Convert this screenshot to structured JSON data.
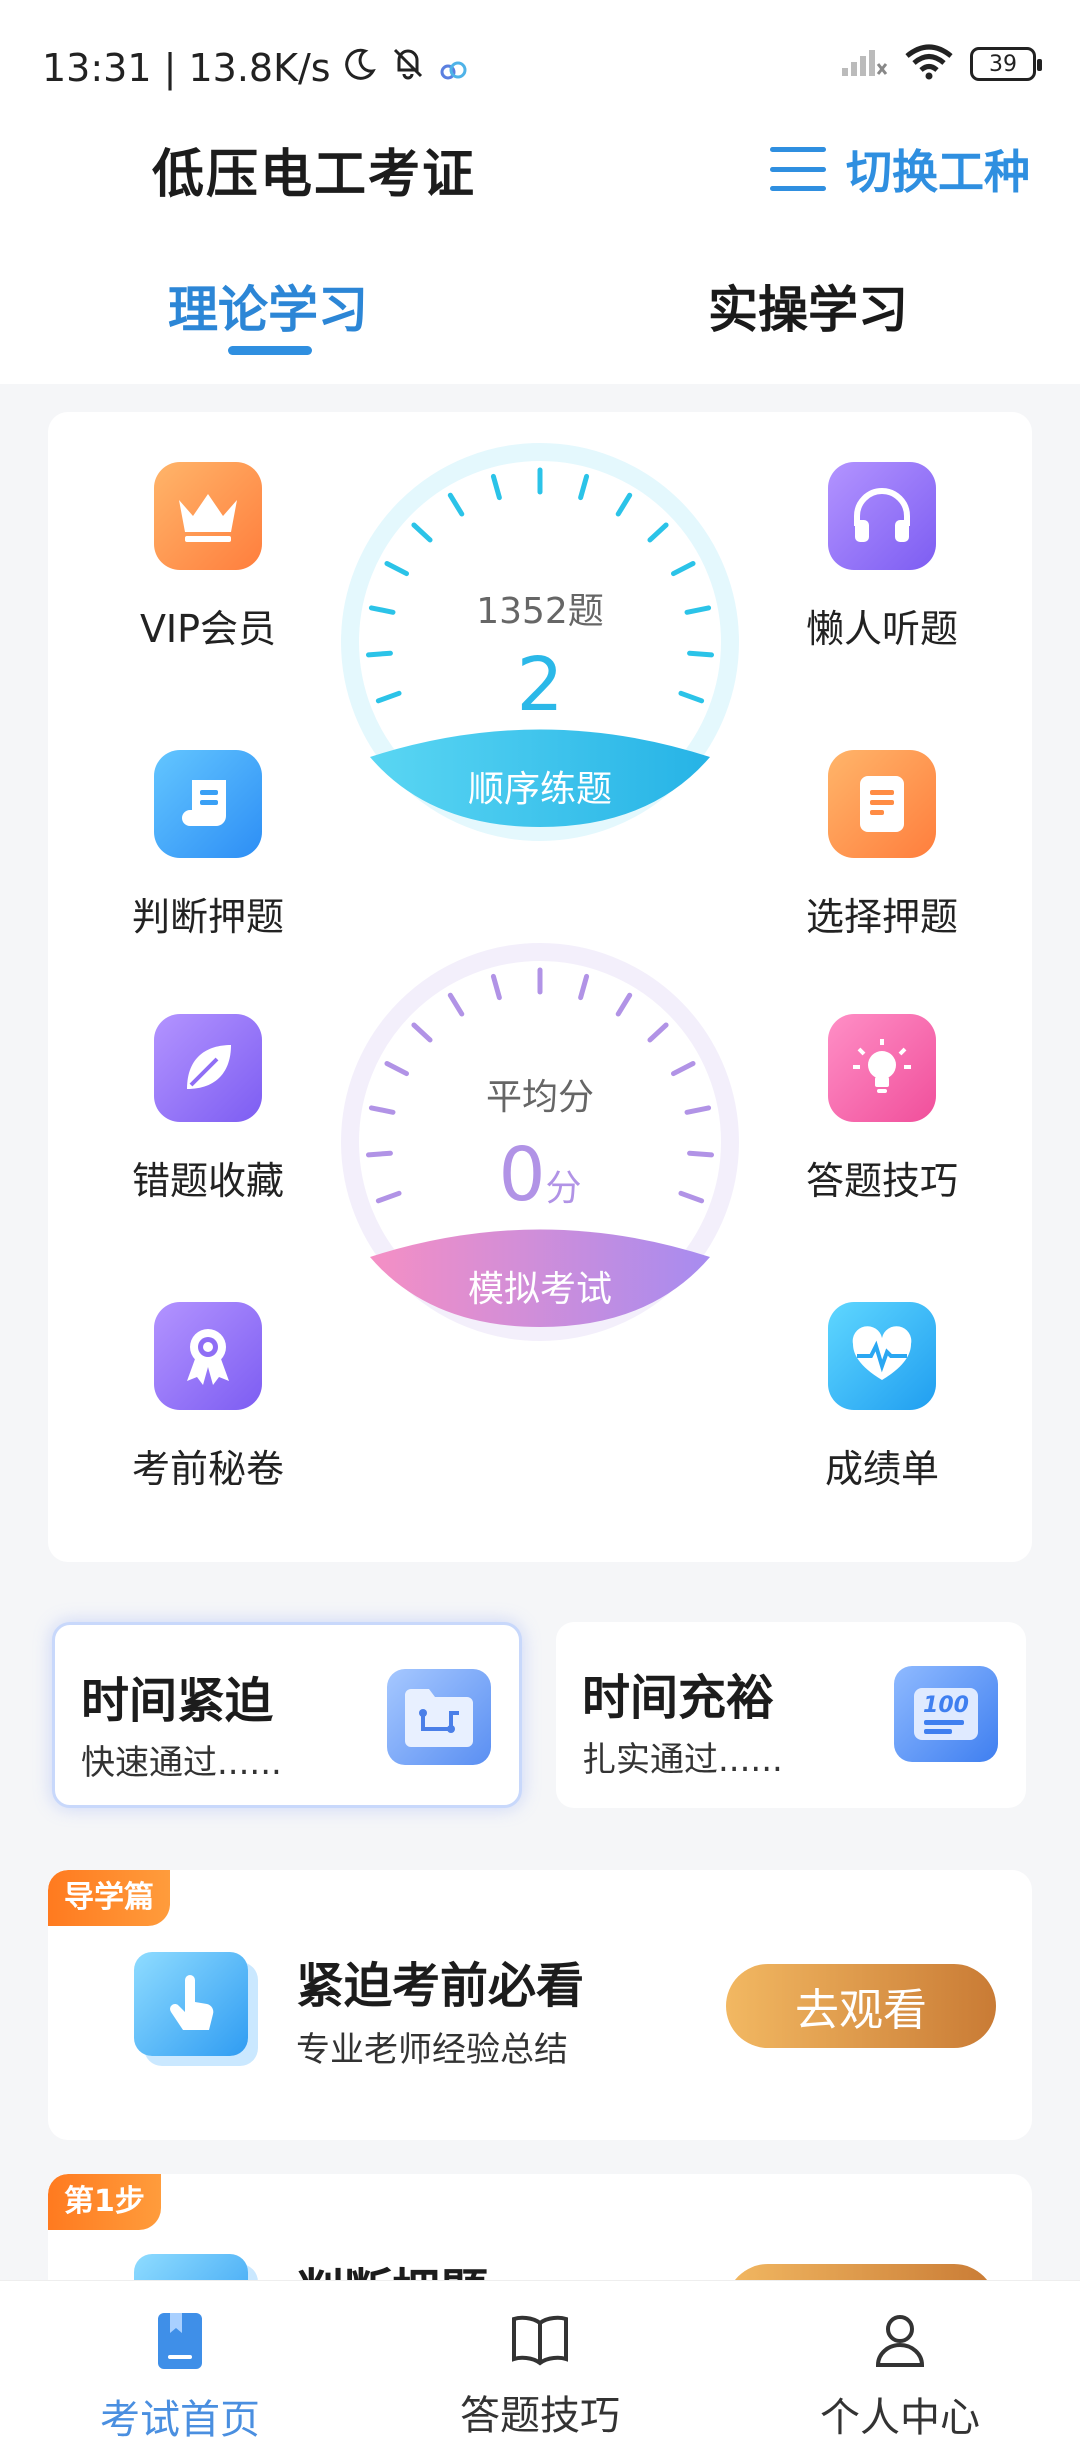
{
  "status_bar": {
    "time_speed": "13:31 | 13.8K/s",
    "battery": "39"
  },
  "header": {
    "title": "低压电工考证",
    "switch_label": "切换工种"
  },
  "tabs": {
    "theory": "理论学习",
    "practice": "实操学习",
    "active": "理论学习"
  },
  "features": {
    "vip": "VIP会员",
    "listen": "懒人听题",
    "judge": "判断押题",
    "choice": "选择押题",
    "mistakes": "错题收藏",
    "tips": "答题技巧",
    "secret": "考前秘卷",
    "report": "成绩单"
  },
  "practice_gauge": {
    "total": "1352题",
    "current": "2",
    "button": "顺序练题"
  },
  "exam_gauge": {
    "label": "平均分",
    "score": "0",
    "unit": "分",
    "button": "模拟考试"
  },
  "plans": {
    "urgent": {
      "title": "时间紧迫",
      "subtitle": "快速通过......"
    },
    "relaxed": {
      "title": "时间充裕",
      "subtitle": "扎实通过......"
    }
  },
  "guides": [
    {
      "tag": "导学篇",
      "title": "紧迫考前必看",
      "subtitle": "专业老师经验总结",
      "button": "去观看"
    },
    {
      "tag": "第1步",
      "title": "判断押题"
    }
  ],
  "bottom_nav": {
    "home": "考试首页",
    "tips": "答题技巧",
    "profile": "个人中心"
  },
  "colors": {
    "accent": "#2f8fe0",
    "practice_gauge": "#2bc3e8",
    "exam_gauge": "#b193e6"
  }
}
